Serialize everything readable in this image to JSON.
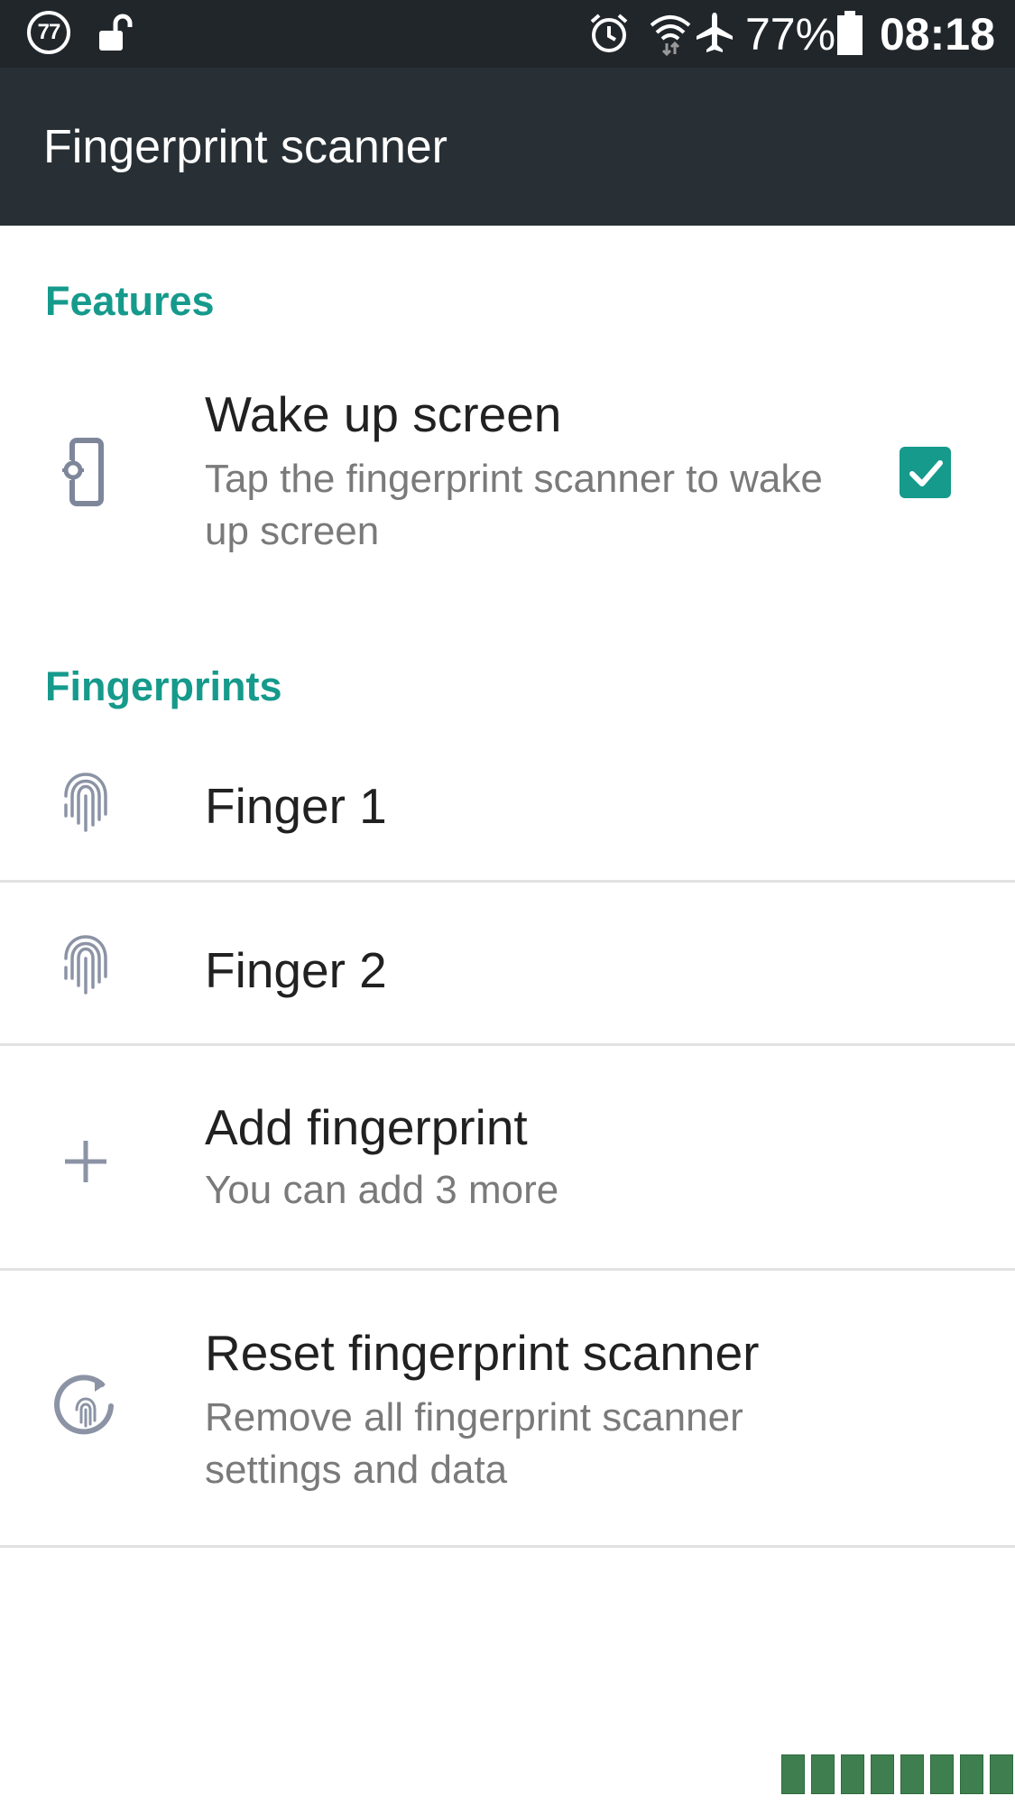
{
  "status_bar": {
    "badge": "77",
    "battery_percent": "77%",
    "time": "08:18",
    "icons": [
      "unlock-icon",
      "alarm-icon",
      "wifi-icon",
      "airplane-icon",
      "battery-icon"
    ]
  },
  "app_bar": {
    "title": "Fingerprint scanner"
  },
  "features": {
    "header": "Features",
    "wake_up": {
      "title": "Wake up screen",
      "subtitle": "Tap the fingerprint scanner to wake up screen",
      "checked": true,
      "icon": "phone-gear-icon"
    }
  },
  "fingerprints": {
    "header": "Fingerprints",
    "items": [
      {
        "label": "Finger 1",
        "icon": "fingerprint-icon"
      },
      {
        "label": "Finger 2",
        "icon": "fingerprint-icon"
      }
    ],
    "add": {
      "title": "Add fingerprint",
      "subtitle": "You can add 3 more",
      "icon": "plus-icon"
    },
    "reset": {
      "title": "Reset fingerprint scanner",
      "subtitle": "Remove all fingerprint scanner settings and data",
      "icon": "reset-fingerprint-icon"
    }
  },
  "colors": {
    "accent": "#159a8c",
    "app_bar": "#283035",
    "status_bar": "#21262b"
  }
}
